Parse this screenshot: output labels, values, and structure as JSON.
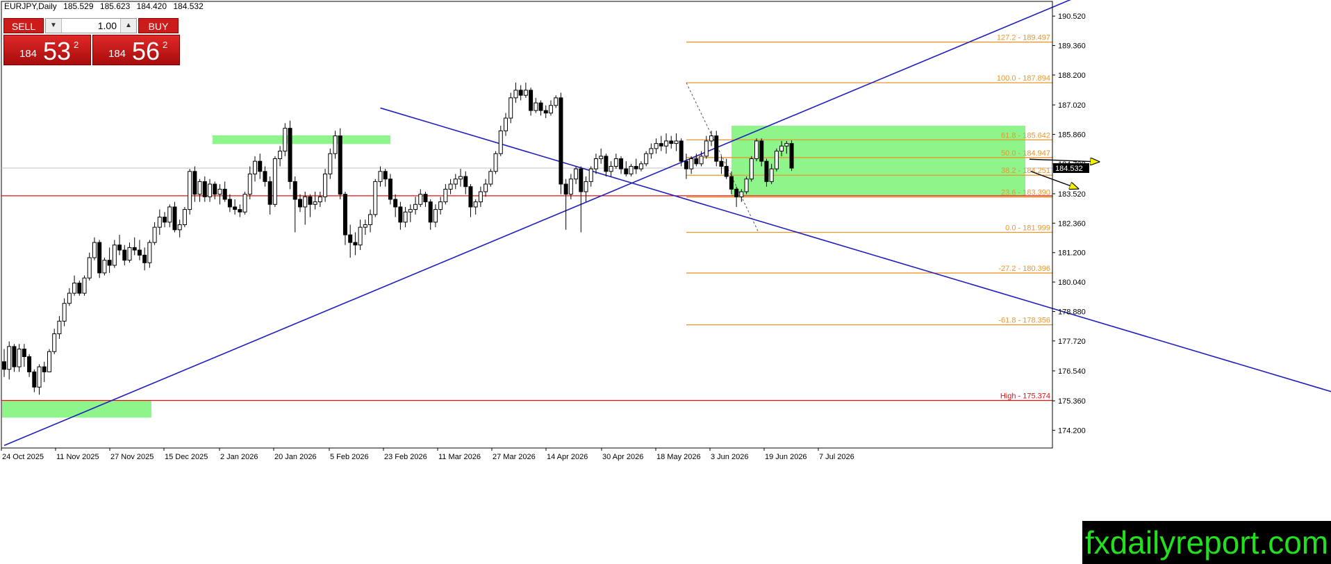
{
  "header": {
    "symbol": "EURJPY,Daily",
    "open": "185.529",
    "high": "185.623",
    "low": "184.420",
    "close": "184.532"
  },
  "trade_panel": {
    "sell_label": "SELL",
    "buy_label": "BUY",
    "quantity": "1.00",
    "sell_price_prefix": "184",
    "sell_price_main": "53",
    "sell_price_sup": "2",
    "buy_price_prefix": "184",
    "buy_price_main": "56",
    "buy_price_sup": "2"
  },
  "watermark": "fxdailyreport.com",
  "colors": {
    "bull": "#ffffff",
    "bear": "#000000",
    "trendline": "#1f1fbf",
    "fib": "#e8962a",
    "fib_text": "#e8962a",
    "horizontal": "#e01010",
    "zone": "#8ef58a",
    "current_price_bg": "#000000"
  },
  "chart_data": {
    "type": "candlestick",
    "title": "EURJPY,Daily",
    "ylim": [
      173.5,
      191.1
    ],
    "y_ticks": [
      "190.520",
      "189.360",
      "188.200",
      "187.020",
      "185.860",
      "184.700",
      "183.520",
      "182.360",
      "181.200",
      "180.040",
      "178.880",
      "177.720",
      "176.540",
      "175.360",
      "174.200"
    ],
    "x_labels": [
      "24 Oct 2025",
      "11 Nov 2025",
      "27 Nov 2025",
      "15 Dec 2025",
      "2 Jan 2026",
      "20 Jan 2026",
      "5 Feb 2026",
      "23 Feb 2026",
      "11 Mar 2026",
      "27 Mar 2026",
      "14 Apr 2026",
      "30 Apr 2026",
      "18 May 2026",
      "3 Jun 2026",
      "19 Jun 2026",
      "7 Jul 2026"
    ],
    "current_price": "184.532",
    "fib_levels": [
      {
        "label": "127.2 - 189.497",
        "value": 189.497
      },
      {
        "label": "100.0 - 187.894",
        "value": 187.894
      },
      {
        "label": "61.8 - 185.642",
        "value": 185.642
      },
      {
        "label": "50.0 - 184.947",
        "value": 184.947
      },
      {
        "label": "38.2 - 184.251",
        "value": 184.251
      },
      {
        "label": "23.6 - 183.390",
        "value": 183.39
      },
      {
        "label": "0.0 - 181.999",
        "value": 181.999
      },
      {
        "label": "-27.2 - 180.396",
        "value": 180.396
      },
      {
        "label": "-61.8 - 178.356",
        "value": 178.356
      }
    ],
    "horizontal_lines": [
      {
        "label": "",
        "value": 183.44
      },
      {
        "label": "High - 175.374",
        "value": 175.374
      }
    ],
    "zones": [
      {
        "x_start": "14 Apr 2026",
        "x_end": "end",
        "y_low": 183.44,
        "y_high": 186.2
      },
      {
        "x_start": "20 Jan 2026",
        "x_end": "5 Feb 2026",
        "y_low": 185.48,
        "y_high": 185.82
      },
      {
        "x_start": "24 Oct 2025",
        "x_end": "27 Nov 2025",
        "y_low": 174.7,
        "y_high": 175.36
      }
    ],
    "trendlines": [
      {
        "from": [
          0,
          173.6
        ],
        "to": [
          213,
          191.2
        ]
      },
      {
        "from": [
          75,
          186.9
        ],
        "to": [
          287,
          174.4
        ]
      }
    ],
    "candles_ohlc": [
      [
        176.9,
        177.4,
        176.3,
        176.6
      ],
      [
        176.6,
        177.7,
        176.2,
        177.5
      ],
      [
        177.5,
        177.6,
        176.5,
        176.7
      ],
      [
        176.7,
        177.6,
        176.5,
        177.4
      ],
      [
        177.4,
        177.6,
        176.7,
        177.1
      ],
      [
        177.1,
        177.2,
        176.3,
        176.5
      ],
      [
        176.5,
        176.6,
        175.7,
        175.9
      ],
      [
        175.9,
        176.8,
        175.6,
        176.7
      ],
      [
        176.7,
        176.9,
        176.1,
        176.5
      ],
      [
        176.5,
        177.4,
        176.5,
        177.3
      ],
      [
        177.3,
        178.2,
        177.2,
        178.0
      ],
      [
        178.0,
        178.7,
        177.8,
        178.5
      ],
      [
        178.5,
        179.4,
        178.3,
        179.2
      ],
      [
        179.2,
        179.8,
        179.1,
        179.6
      ],
      [
        179.6,
        180.3,
        179.5,
        180.0
      ],
      [
        180.0,
        180.1,
        179.5,
        179.6
      ],
      [
        179.6,
        180.3,
        179.5,
        180.2
      ],
      [
        180.2,
        181.2,
        180.1,
        181.0
      ],
      [
        181.0,
        181.8,
        180.9,
        181.6
      ],
      [
        181.6,
        181.7,
        180.2,
        180.4
      ],
      [
        180.4,
        181.0,
        180.3,
        180.9
      ],
      [
        180.9,
        181.4,
        180.4,
        180.7
      ],
      [
        180.7,
        181.7,
        180.6,
        181.5
      ],
      [
        181.5,
        181.9,
        181.1,
        181.3
      ],
      [
        181.3,
        181.5,
        180.7,
        180.9
      ],
      [
        180.9,
        181.6,
        180.8,
        181.4
      ],
      [
        181.4,
        181.8,
        181.1,
        181.3
      ],
      [
        181.3,
        181.7,
        180.9,
        181.1
      ],
      [
        181.1,
        181.4,
        180.5,
        180.8
      ],
      [
        180.8,
        181.7,
        180.6,
        181.6
      ],
      [
        181.6,
        182.4,
        181.5,
        182.2
      ],
      [
        182.2,
        182.9,
        181.9,
        182.6
      ],
      [
        182.6,
        182.8,
        182.2,
        182.4
      ],
      [
        182.4,
        183.1,
        182.2,
        183.0
      ],
      [
        183.0,
        183.2,
        182.0,
        182.1
      ],
      [
        182.1,
        182.5,
        181.8,
        182.3
      ],
      [
        182.3,
        183.0,
        182.2,
        182.9
      ],
      [
        182.9,
        184.5,
        182.7,
        184.4
      ],
      [
        184.4,
        184.6,
        183.2,
        183.5
      ],
      [
        183.5,
        184.1,
        183.2,
        184.0
      ],
      [
        184.0,
        184.2,
        183.2,
        183.4
      ],
      [
        183.4,
        184.1,
        183.2,
        183.9
      ],
      [
        183.9,
        184.0,
        183.3,
        183.5
      ],
      [
        183.5,
        183.9,
        183.1,
        183.7
      ],
      [
        183.7,
        184.0,
        183.2,
        183.3
      ],
      [
        183.3,
        183.5,
        182.8,
        183.0
      ],
      [
        183.0,
        183.3,
        182.7,
        182.9
      ],
      [
        182.9,
        183.1,
        182.6,
        182.8
      ],
      [
        182.8,
        183.6,
        182.7,
        183.5
      ],
      [
        183.5,
        184.6,
        183.3,
        184.3
      ],
      [
        184.3,
        185.0,
        184.0,
        184.8
      ],
      [
        184.8,
        185.1,
        184.1,
        184.4
      ],
      [
        184.4,
        184.6,
        183.8,
        184.0
      ],
      [
        184.0,
        184.2,
        182.7,
        183.1
      ],
      [
        183.1,
        185.0,
        183.0,
        184.9
      ],
      [
        184.9,
        185.4,
        184.6,
        185.2
      ],
      [
        185.2,
        186.3,
        185.0,
        186.1
      ],
      [
        186.1,
        186.4,
        183.7,
        184.0
      ],
      [
        184.0,
        184.2,
        182.0,
        183.3
      ],
      [
        183.3,
        183.5,
        182.8,
        183.0
      ],
      [
        183.0,
        183.6,
        182.3,
        183.4
      ],
      [
        183.4,
        183.5,
        182.6,
        183.1
      ],
      [
        183.1,
        183.6,
        182.9,
        183.2
      ],
      [
        183.2,
        183.6,
        183.0,
        183.4
      ],
      [
        183.4,
        184.5,
        183.2,
        184.3
      ],
      [
        184.3,
        185.3,
        184.1,
        185.1
      ],
      [
        185.1,
        186.0,
        184.9,
        185.8
      ],
      [
        185.8,
        186.1,
        183.3,
        183.5
      ],
      [
        183.5,
        183.6,
        181.5,
        181.9
      ],
      [
        181.9,
        182.3,
        181.0,
        181.6
      ],
      [
        181.6,
        182.0,
        181.1,
        181.5
      ],
      [
        181.5,
        182.5,
        181.3,
        182.2
      ],
      [
        182.2,
        182.5,
        181.9,
        182.3
      ],
      [
        182.3,
        182.9,
        182.0,
        182.7
      ],
      [
        182.7,
        184.1,
        182.6,
        184.0
      ],
      [
        184.0,
        184.6,
        183.8,
        184.4
      ],
      [
        184.4,
        184.5,
        183.8,
        184.1
      ],
      [
        184.1,
        184.3,
        183.1,
        183.3
      ],
      [
        183.3,
        183.5,
        182.6,
        183.0
      ],
      [
        183.0,
        183.2,
        182.1,
        182.4
      ],
      [
        182.4,
        183.0,
        182.2,
        182.8
      ],
      [
        182.8,
        183.1,
        182.4,
        182.9
      ],
      [
        182.9,
        183.4,
        182.7,
        183.1
      ],
      [
        183.1,
        183.7,
        183.0,
        183.5
      ],
      [
        183.5,
        183.6,
        183.0,
        183.2
      ],
      [
        183.2,
        183.3,
        182.1,
        182.4
      ],
      [
        182.4,
        183.1,
        182.2,
        182.9
      ],
      [
        182.9,
        183.4,
        182.7,
        183.2
      ],
      [
        183.2,
        183.9,
        183.1,
        183.7
      ],
      [
        183.7,
        184.1,
        183.5,
        183.9
      ],
      [
        183.9,
        184.3,
        183.7,
        184.1
      ],
      [
        184.1,
        184.5,
        183.8,
        184.2
      ],
      [
        184.2,
        184.4,
        183.5,
        183.8
      ],
      [
        183.8,
        183.9,
        182.6,
        183.0
      ],
      [
        183.0,
        183.3,
        182.7,
        183.2
      ],
      [
        183.2,
        183.8,
        183.0,
        183.6
      ],
      [
        183.6,
        184.1,
        183.4,
        183.9
      ],
      [
        183.9,
        184.5,
        183.8,
        184.4
      ],
      [
        184.4,
        185.2,
        184.3,
        185.1
      ],
      [
        185.1,
        186.2,
        185.0,
        186.0
      ],
      [
        186.0,
        186.7,
        185.8,
        186.5
      ],
      [
        186.5,
        187.5,
        186.3,
        187.3
      ],
      [
        187.3,
        187.9,
        187.1,
        187.6
      ],
      [
        187.6,
        187.8,
        187.2,
        187.4
      ],
      [
        187.4,
        187.9,
        187.3,
        187.6
      ],
      [
        187.6,
        187.7,
        186.6,
        186.8
      ],
      [
        186.8,
        187.3,
        186.7,
        187.1
      ],
      [
        187.1,
        187.2,
        186.6,
        186.8
      ],
      [
        186.8,
        187.0,
        186.5,
        186.7
      ],
      [
        186.7,
        187.2,
        186.6,
        187.0
      ],
      [
        187.0,
        187.4,
        186.9,
        187.3
      ],
      [
        187.3,
        187.5,
        183.5,
        183.9
      ],
      [
        183.9,
        184.1,
        182.1,
        183.5
      ],
      [
        183.5,
        184.3,
        183.3,
        184.1
      ],
      [
        184.1,
        184.6,
        183.9,
        184.5
      ],
      [
        184.5,
        184.6,
        182.0,
        183.6
      ],
      [
        183.6,
        184.2,
        183.2,
        184.0
      ],
      [
        184.0,
        184.6,
        183.8,
        184.5
      ],
      [
        184.5,
        185.1,
        184.3,
        184.9
      ],
      [
        184.9,
        185.3,
        184.7,
        185.0
      ],
      [
        185.0,
        185.1,
        184.2,
        184.4
      ],
      [
        184.4,
        184.8,
        184.2,
        184.6
      ],
      [
        184.6,
        185.1,
        184.5,
        184.9
      ],
      [
        184.9,
        185.0,
        184.3,
        184.5
      ],
      [
        184.5,
        184.8,
        184.2,
        184.3
      ],
      [
        184.3,
        184.7,
        184.2,
        184.6
      ],
      [
        184.6,
        184.9,
        184.3,
        184.5
      ],
      [
        184.5,
        184.8,
        184.4,
        184.7
      ],
      [
        184.7,
        185.2,
        184.6,
        185.1
      ],
      [
        185.1,
        185.5,
        184.9,
        185.3
      ],
      [
        185.3,
        185.7,
        185.1,
        185.5
      ],
      [
        185.5,
        185.8,
        185.2,
        185.4
      ],
      [
        185.4,
        185.9,
        185.1,
        185.6
      ],
      [
        185.6,
        185.8,
        185.3,
        185.5
      ],
      [
        185.5,
        185.9,
        185.2,
        185.6
      ],
      [
        185.6,
        185.7,
        184.6,
        184.8
      ],
      [
        184.8,
        185.1,
        184.1,
        184.5
      ],
      [
        184.5,
        185.0,
        184.3,
        184.9
      ],
      [
        184.9,
        185.1,
        184.6,
        184.7
      ],
      [
        184.7,
        185.2,
        184.6,
        185.0
      ],
      [
        185.0,
        185.8,
        184.9,
        185.6
      ],
      [
        185.6,
        186.0,
        185.4,
        185.8
      ],
      [
        185.8,
        186.0,
        184.6,
        184.8
      ],
      [
        184.8,
        185.0,
        184.3,
        184.6
      ],
      [
        184.6,
        184.9,
        184.1,
        184.2
      ],
      [
        184.2,
        184.4,
        183.5,
        183.7
      ],
      [
        183.7,
        183.8,
        183.0,
        183.4
      ],
      [
        183.4,
        183.7,
        183.2,
        183.6
      ],
      [
        183.6,
        184.2,
        183.5,
        184.1
      ],
      [
        184.1,
        185.0,
        184.0,
        184.9
      ],
      [
        184.9,
        185.7,
        184.8,
        185.6
      ],
      [
        185.6,
        185.7,
        184.6,
        184.8
      ],
      [
        184.8,
        184.9,
        183.8,
        184.0
      ],
      [
        184.0,
        184.7,
        183.9,
        184.5
      ],
      [
        184.5,
        185.3,
        184.4,
        185.2
      ],
      [
        185.2,
        185.6,
        185.0,
        185.4
      ],
      [
        185.4,
        185.6,
        185.1,
        185.5
      ],
      [
        185.5,
        185.62,
        184.42,
        184.53
      ]
    ]
  }
}
